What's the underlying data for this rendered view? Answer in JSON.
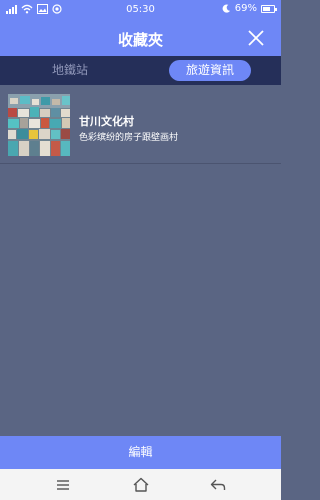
{
  "status_bar": {
    "time": "05:30",
    "battery": "69%",
    "icons": [
      "signal-icon",
      "wifi-icon",
      "gallery-icon",
      "location-icon",
      "moon-icon",
      "battery-icon"
    ]
  },
  "header": {
    "title": "收藏夾",
    "close_icon": "close-icon"
  },
  "tabs": [
    {
      "label": "地鐵站",
      "active": false
    },
    {
      "label": "旅遊資訊",
      "active": true
    }
  ],
  "favorites": [
    {
      "title": "甘川文化村",
      "subtitle": "色彩缤纷的房子跟壁画村",
      "thumbnail": "colorful-village-thumbnail"
    }
  ],
  "footer": {
    "edit_label": "編輯"
  },
  "nav": {
    "icons": [
      "menu-icon",
      "home-icon",
      "back-icon"
    ]
  },
  "colors": {
    "accent": "#6e87f6",
    "tab_bar": "#252f59",
    "background": "#5a6583"
  }
}
